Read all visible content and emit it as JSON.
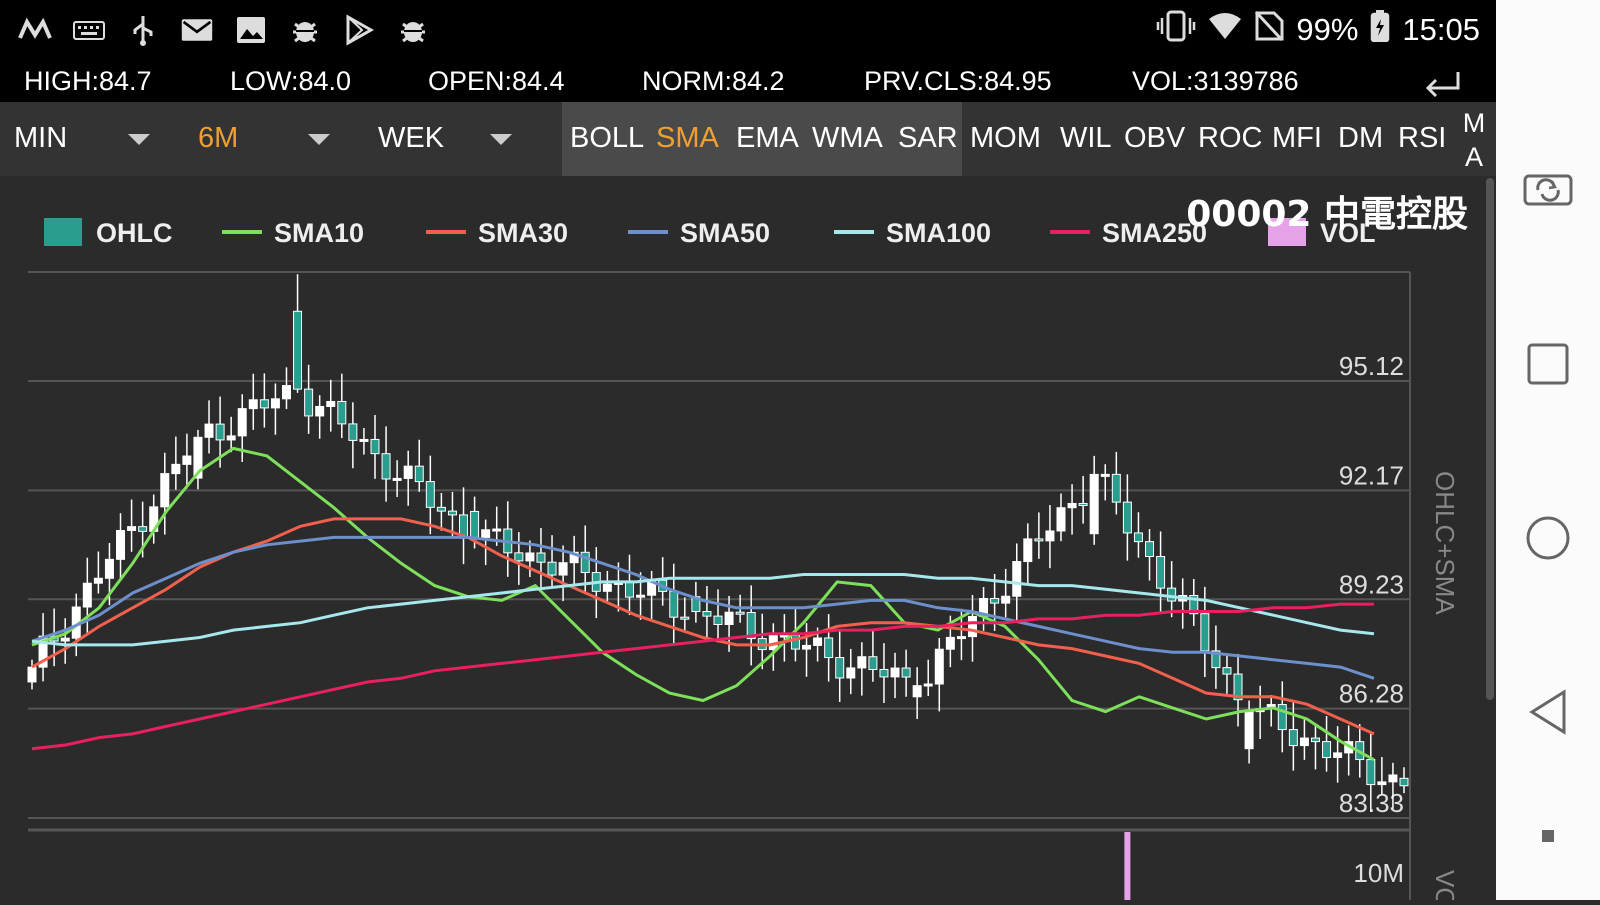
{
  "status_bar": {
    "battery": "99%",
    "time": "15:05",
    "left_icons": [
      "m-app-icon",
      "keyboard-icon",
      "usb-icon",
      "gmail-icon",
      "gallery-icon",
      "bug-icon",
      "play-store-icon",
      "bug-icon-2"
    ],
    "right_icons": [
      "vibrate-icon",
      "wifi-icon",
      "no-sim-icon",
      "battery-icon"
    ]
  },
  "quote": {
    "high": "HIGH:84.7",
    "low": "LOW:84.0",
    "open": "OPEN:84.4",
    "norm": "NORM:84.2",
    "prev_close": "PRV.CLS:84.95",
    "volume": "VOL:3139786"
  },
  "toolbar": {
    "selectors": [
      {
        "label": "MIN",
        "active": false
      },
      {
        "label": "6M",
        "active": true
      },
      {
        "label": "WEK",
        "active": false
      }
    ],
    "indicators": [
      "BOLL",
      "SMA",
      "EMA",
      "WMA",
      "SAR",
      "MOM",
      "WIL",
      "OBV",
      "ROC",
      "MFI",
      "DM",
      "RSI"
    ],
    "active_indicator": "SMA",
    "ma_label_1": "M",
    "ma_label_2": "A"
  },
  "colors": {
    "ohlc": "#2a9d8f",
    "sma10": "#7ee05a",
    "sma30": "#f0604d",
    "sma50": "#6d8fcb",
    "sma100": "#a6e8ec",
    "sma250": "#e8205f",
    "vol": "#e6a2e8",
    "accent": "#f0a030"
  },
  "chart_data": {
    "type": "candlestick",
    "title": "00002 中電控股",
    "legend": [
      "OHLC",
      "SMA10",
      "SMA30",
      "SMA50",
      "SMA100",
      "SMA250",
      "VOL"
    ],
    "ylabel": "OHLC+SMA",
    "ylabel_vol": "VO",
    "yticks": [
      "95.12",
      "92.17",
      "89.23",
      "86.28",
      "83.33"
    ],
    "ylim": [
      83.33,
      98.06
    ],
    "vol_tick": "10M",
    "candle_count": 125,
    "sample_candles": [
      {
        "i": 0,
        "o": 87.0,
        "h": 87.6,
        "l": 86.8,
        "c": 87.4
      },
      {
        "i": 15,
        "o": 92.5,
        "h": 93.8,
        "l": 92.2,
        "c": 93.6
      },
      {
        "i": 24,
        "o": 97.0,
        "h": 98.0,
        "l": 94.8,
        "c": 94.9
      },
      {
        "i": 40,
        "o": 91.6,
        "h": 92.0,
        "l": 90.6,
        "c": 90.9
      },
      {
        "i": 60,
        "o": 89.3,
        "h": 89.7,
        "l": 88.6,
        "c": 88.9
      },
      {
        "i": 80,
        "o": 86.6,
        "h": 87.4,
        "l": 86.0,
        "c": 86.9
      },
      {
        "i": 96,
        "o": 91.0,
        "h": 93.1,
        "l": 90.7,
        "c": 92.6
      },
      {
        "i": 110,
        "o": 85.2,
        "h": 86.5,
        "l": 84.8,
        "c": 86.2
      },
      {
        "i": 124,
        "o": 84.4,
        "h": 84.7,
        "l": 84.0,
        "c": 84.2
      }
    ],
    "series": [
      {
        "name": "SMA10",
        "values": [
          88.0,
          88.3,
          89.0,
          90.2,
          91.6,
          92.7,
          93.3,
          93.1,
          92.4,
          91.7,
          90.9,
          90.2,
          89.6,
          89.3,
          89.2,
          89.6,
          88.7,
          87.8,
          87.2,
          86.7,
          86.5,
          86.9,
          87.7,
          88.6,
          89.7,
          89.6,
          88.6,
          88.4,
          88.9,
          88.5,
          87.6,
          86.5,
          86.2,
          86.6,
          86.3,
          86.0,
          86.2,
          86.3,
          86.0,
          85.4,
          84.9
        ]
      },
      {
        "name": "SMA30",
        "values": [
          87.4,
          87.9,
          88.5,
          89.0,
          89.5,
          90.1,
          90.5,
          90.8,
          91.2,
          91.4,
          91.4,
          91.4,
          91.2,
          90.9,
          90.4,
          90.0,
          89.6,
          89.2,
          88.8,
          88.5,
          88.2,
          88.0,
          88.0,
          88.2,
          88.5,
          88.6,
          88.6,
          88.5,
          88.4,
          88.2,
          88.0,
          87.9,
          87.7,
          87.5,
          87.1,
          86.7,
          86.6,
          86.6,
          86.4,
          86.0,
          85.6
        ]
      },
      {
        "name": "SMA50",
        "values": [
          88.1,
          88.4,
          88.8,
          89.4,
          89.8,
          90.2,
          90.5,
          90.7,
          90.8,
          90.9,
          90.9,
          90.9,
          90.9,
          90.9,
          90.8,
          90.7,
          90.5,
          90.2,
          89.9,
          89.5,
          89.2,
          89.0,
          89.0,
          89.0,
          89.1,
          89.2,
          89.2,
          89.0,
          88.9,
          88.7,
          88.5,
          88.3,
          88.1,
          87.9,
          87.8,
          87.8,
          87.7,
          87.6,
          87.5,
          87.4,
          87.1
        ]
      },
      {
        "name": "SMA100",
        "values": [
          88.1,
          88.0,
          88.0,
          88.0,
          88.1,
          88.2,
          88.4,
          88.5,
          88.6,
          88.8,
          89.0,
          89.1,
          89.2,
          89.3,
          89.4,
          89.5,
          89.6,
          89.7,
          89.7,
          89.8,
          89.8,
          89.8,
          89.8,
          89.9,
          89.9,
          89.9,
          89.9,
          89.8,
          89.8,
          89.7,
          89.6,
          89.6,
          89.5,
          89.4,
          89.3,
          89.2,
          89.0,
          88.8,
          88.6,
          88.4,
          88.3
        ]
      },
      {
        "name": "SMA250",
        "values": [
          85.2,
          85.3,
          85.5,
          85.6,
          85.8,
          86.0,
          86.2,
          86.4,
          86.6,
          86.8,
          87.0,
          87.1,
          87.3,
          87.4,
          87.5,
          87.6,
          87.7,
          87.8,
          87.9,
          88.0,
          88.1,
          88.2,
          88.3,
          88.3,
          88.4,
          88.4,
          88.5,
          88.5,
          88.6,
          88.6,
          88.7,
          88.7,
          88.8,
          88.8,
          88.9,
          88.9,
          88.9,
          89.0,
          89.0,
          89.1,
          89.1
        ]
      }
    ],
    "volume_spike_index": 99
  },
  "nav": {
    "buttons": [
      "rotate-screen-button",
      "recents-button",
      "home-button",
      "back-button"
    ]
  }
}
